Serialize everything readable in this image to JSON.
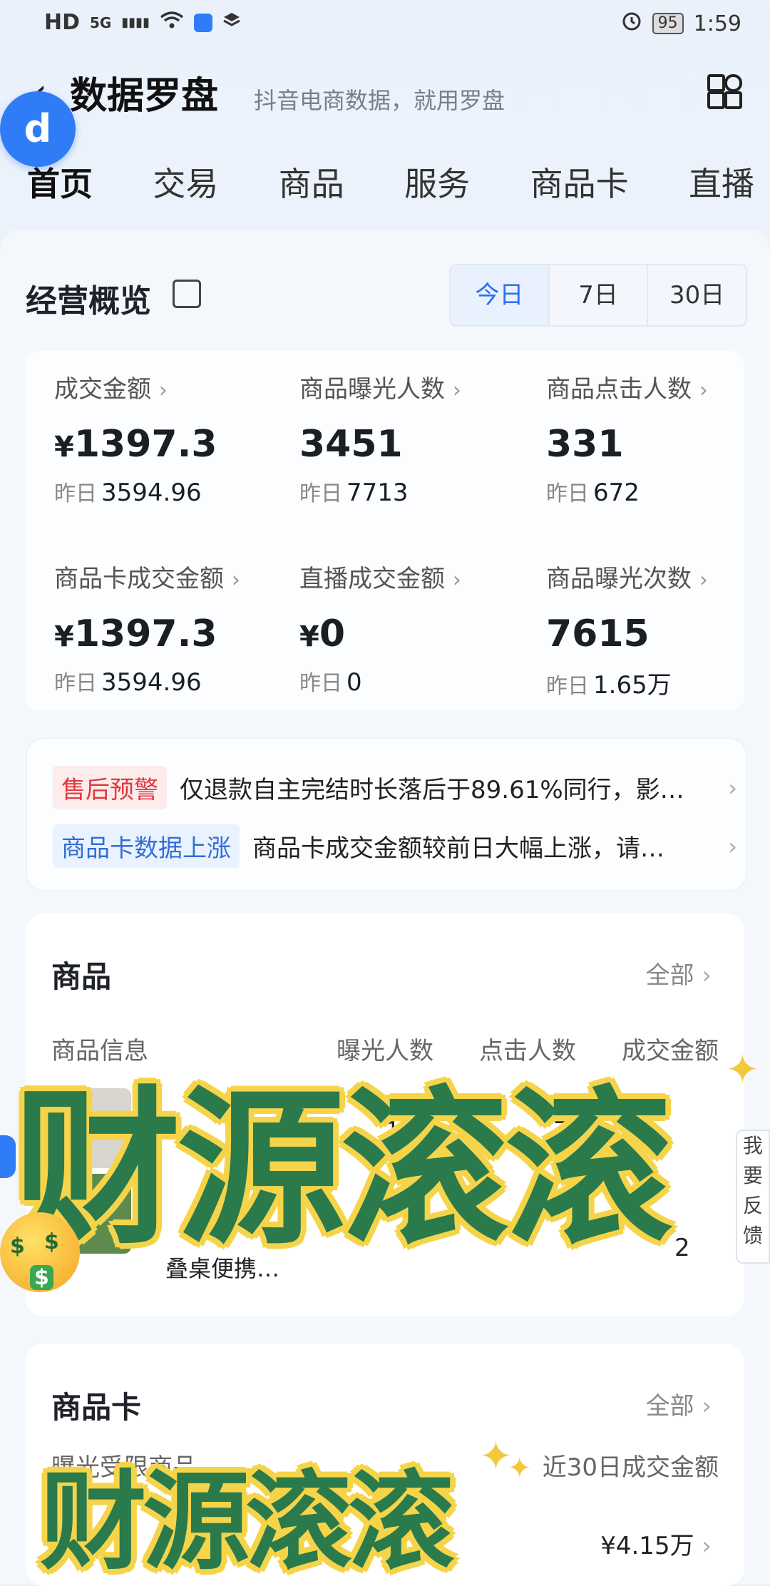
{
  "status_bar": {
    "left_icons": [
      "HD",
      "5G",
      "▮▮▮▮",
      "wifi-icon",
      "app-icon",
      "layers-icon"
    ],
    "battery": "95",
    "time": "1:59"
  },
  "header": {
    "title": "数据罗盘",
    "subtitle": "抖音电商数据，就用罗盘",
    "logo_glyph": "d"
  },
  "tabs": [
    "首页",
    "交易",
    "商品",
    "服务",
    "商品卡",
    "直播"
  ],
  "overview": {
    "title": "经营概览",
    "ranges": [
      "今日",
      "7日",
      "30日"
    ],
    "prev_label": "昨日",
    "metrics": [
      {
        "label": "成交金额",
        "currency": "¥",
        "value": "1397.3",
        "prev": "3594.96"
      },
      {
        "label": "商品曝光人数",
        "currency": "",
        "value": "3451",
        "prev": "7713"
      },
      {
        "label": "商品点击人数",
        "currency": "",
        "value": "331",
        "prev": "672"
      },
      {
        "label": "商品卡成交金额",
        "currency": "¥",
        "value": "1397.3",
        "prev": "3594.96"
      },
      {
        "label": "直播成交金额",
        "currency": "¥",
        "value": "0",
        "prev": "0"
      },
      {
        "label": "商品曝光次数",
        "currency": "",
        "value": "7615",
        "prev": "1.65万"
      }
    ]
  },
  "alerts": [
    {
      "tag": "售后预警",
      "text": "仅退款自主完结时长落后于89.61%同行，影…"
    },
    {
      "tag": "商品卡数据上涨",
      "text": "商品卡成交金额较前日大幅上涨，请…"
    }
  ],
  "products": {
    "title": "商品",
    "all_label": "全部",
    "columns": [
      "商品信息",
      "曝光人数",
      "点击人数",
      "成交金额"
    ],
    "row_partial": {
      "name_line": "叠桌便携…",
      "exposure": "1",
      "clicks": "74",
      "amount": "2"
    }
  },
  "side_feedback": "我要反馈",
  "product_card": {
    "title": "商品卡",
    "all_label": "全部",
    "left_header": "曝光受限商品",
    "right_header": "近30日成交金额",
    "amount": "¥4.15万"
  },
  "overlay_text": "财源滚滚",
  "overlay_text_2": "财源滚滚",
  "emoji_glyphs": [
    "$",
    "$",
    "$"
  ],
  "chevron": "›"
}
